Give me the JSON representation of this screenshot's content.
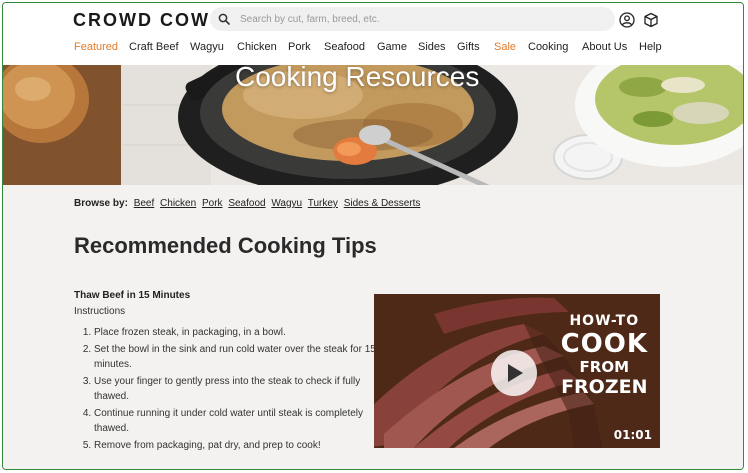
{
  "header": {
    "logo": "CROWD COW",
    "search_placeholder": "Search by cut, farm, breed, etc.",
    "icons": [
      "search-icon",
      "account-icon",
      "cart-box-icon"
    ]
  },
  "nav": {
    "items": [
      {
        "label": "Featured",
        "accent": true
      },
      {
        "label": "Craft Beef"
      },
      {
        "label": "Wagyu"
      },
      {
        "label": "Chicken"
      },
      {
        "label": "Pork"
      },
      {
        "label": "Seafood"
      },
      {
        "label": "Game"
      },
      {
        "label": "Sides"
      },
      {
        "label": "Gifts"
      },
      {
        "label": "Sale",
        "accent": true
      },
      {
        "label": "Cooking"
      },
      {
        "label": "About Us"
      },
      {
        "label": "Help"
      }
    ]
  },
  "hero": {
    "title": "Cooking Resources"
  },
  "browse": {
    "label": "Browse by:",
    "links": [
      "Beef",
      "Chicken",
      "Pork",
      "Seafood",
      "Wagyu",
      "Turkey",
      "Sides & Desserts"
    ]
  },
  "section": {
    "title": "Recommended Cooking Tips",
    "tip": {
      "title": "Thaw Beef in 15 Minutes",
      "subtitle": "Instructions",
      "steps": [
        "Place frozen steak, in packaging, in a bowl.",
        "Set the bowl in the sink and run cold water over the steak for 15 minutes.",
        "Use your finger to gently press into the steak to check if fully thawed.",
        "Continue running it under cold water until steak is completely thawed.",
        "Remove from packaging, pat dry, and prep to cook!"
      ]
    },
    "video": {
      "line1": "HOW-TO",
      "line2": "COOK",
      "line3": "FROM",
      "line4": "FROZEN",
      "duration": "01:01"
    }
  },
  "colors": {
    "accent": "#e07b2a",
    "frame": "#2f8a3a",
    "content_bg": "#f3f2f0"
  }
}
